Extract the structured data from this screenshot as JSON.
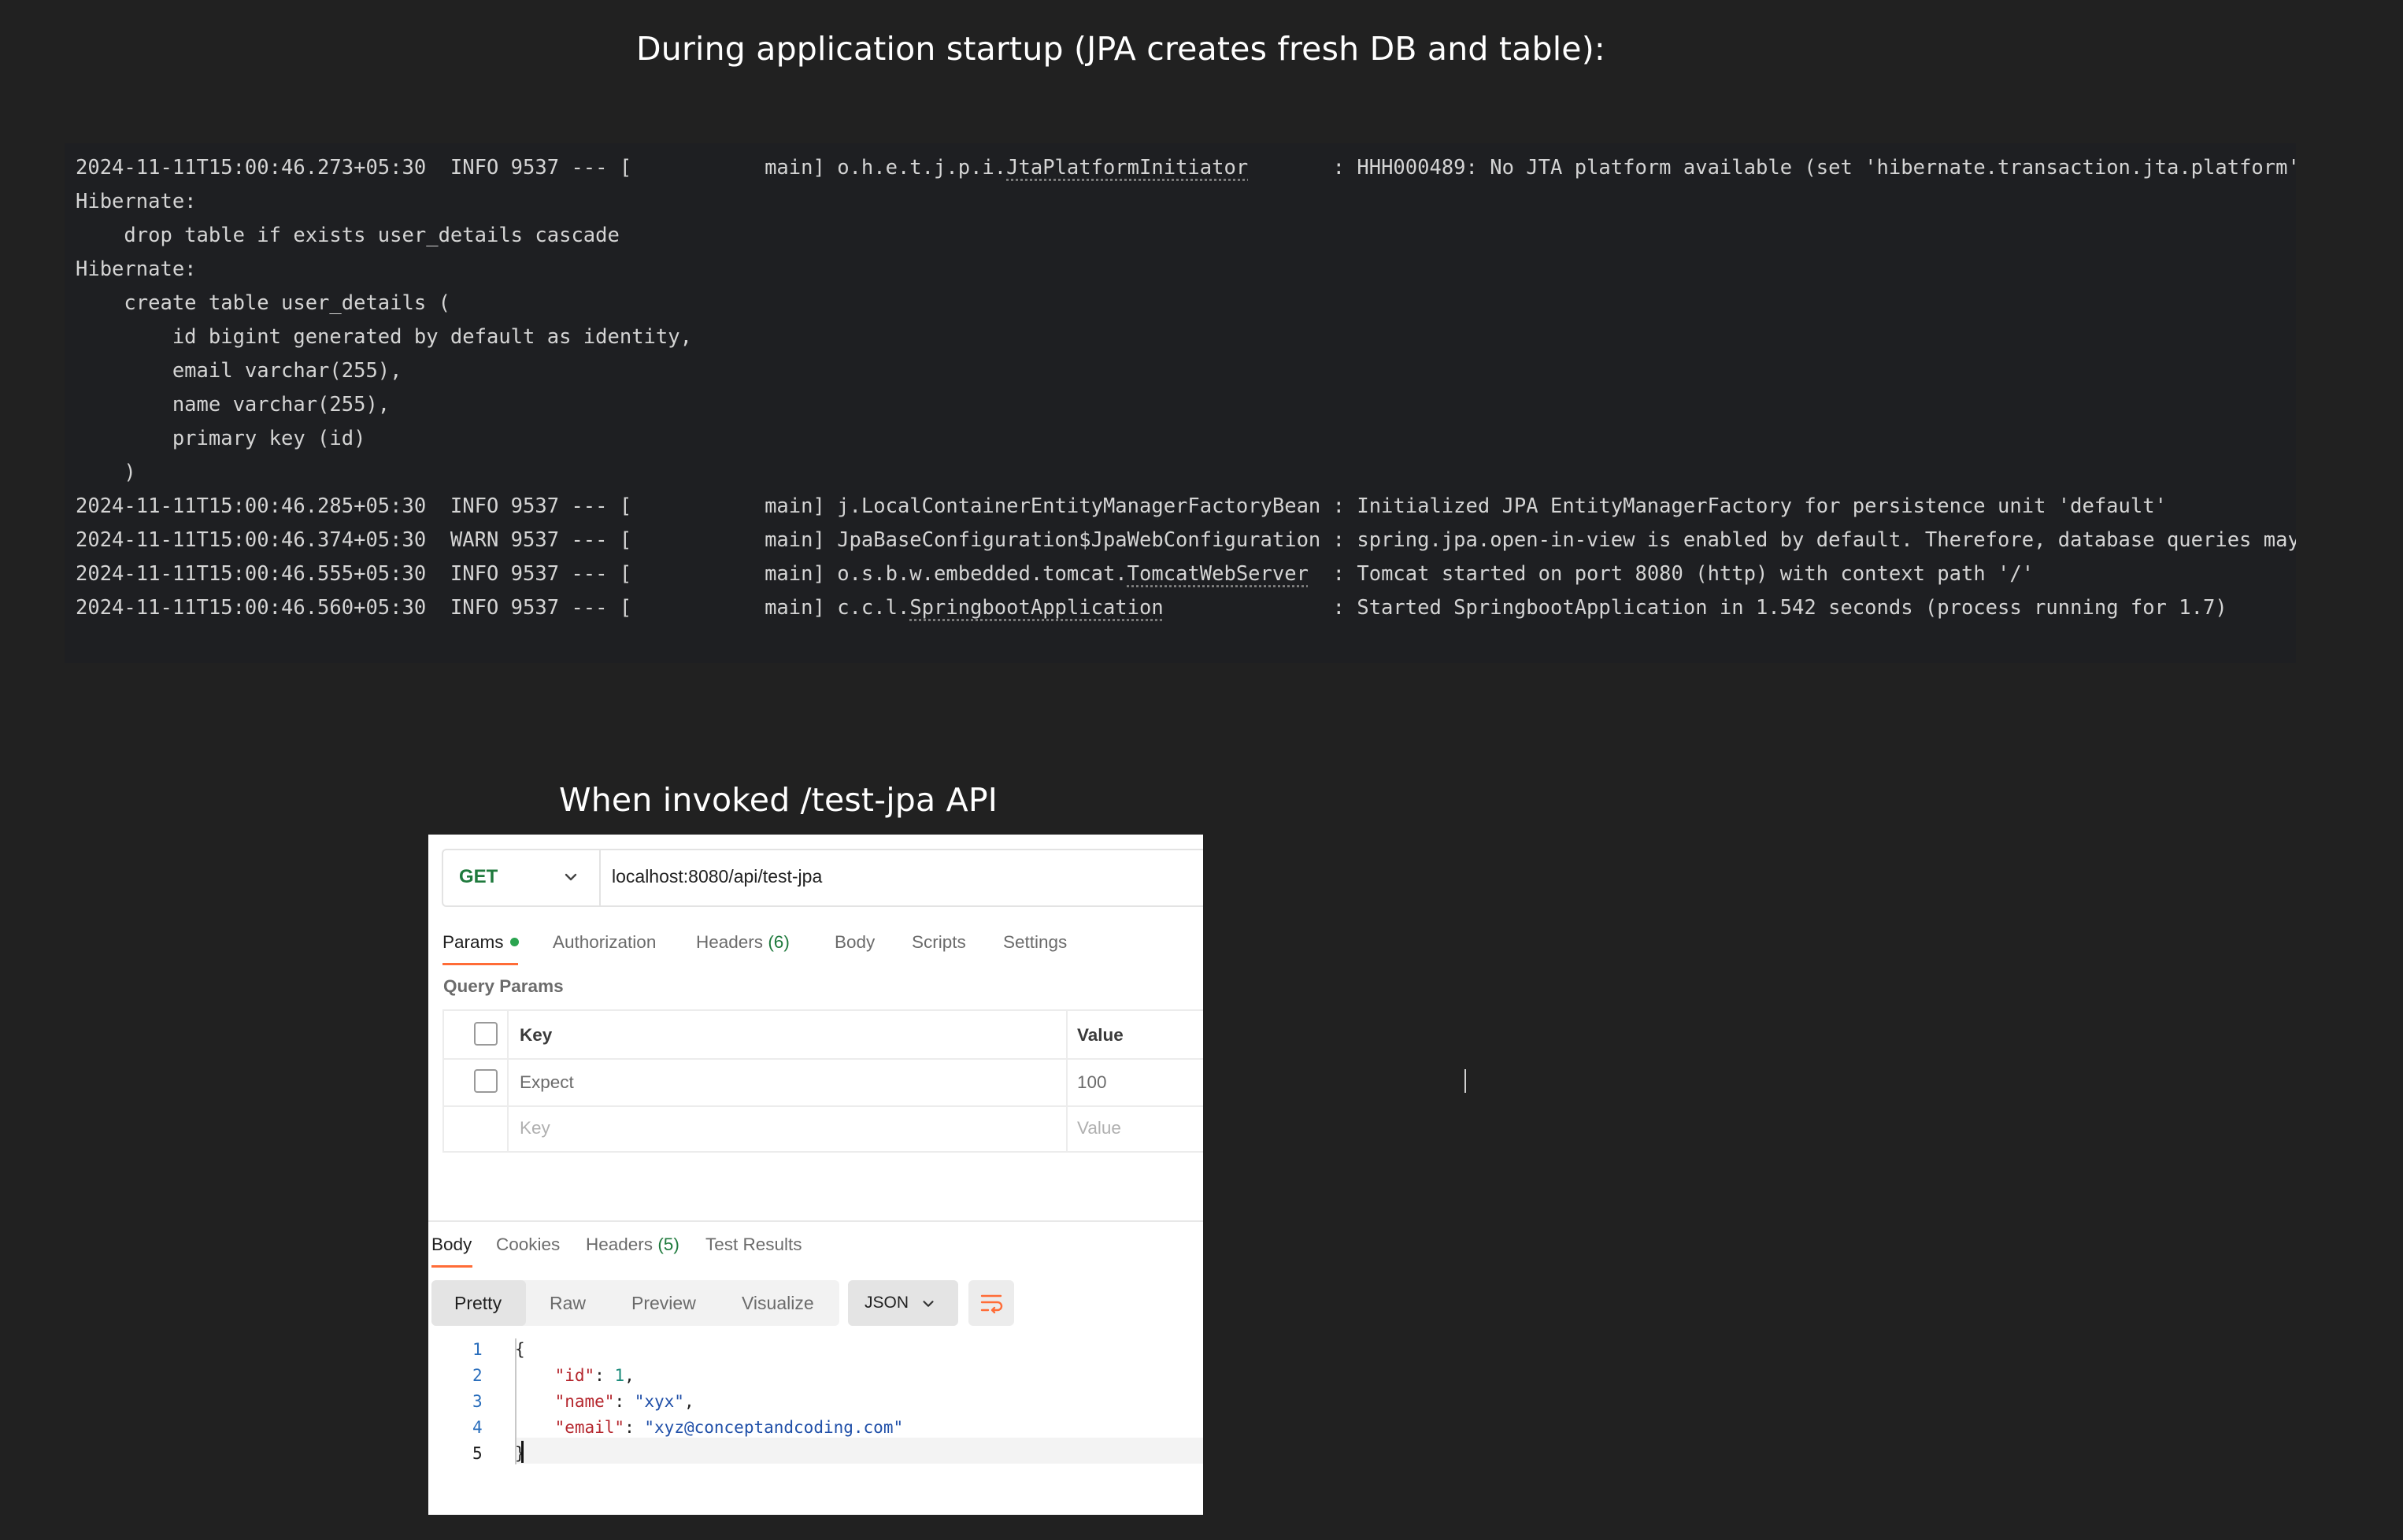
{
  "headings": {
    "startup": "During application startup (JPA creates fresh DB and table):",
    "api": "When invoked /test-jpa API"
  },
  "log": {
    "lines": [
      {
        "segments": [
          "2024-11-11T15:00:46.273+05:30  INFO 9537 --- [           main] o.h.e.t.j.p.i.",
          "JtaPlatformInitiator",
          "       : HHH000489: No JTA platform available (set 'hibernate.transaction.jta.platform' t"
        ]
      },
      {
        "segments": [
          "Hibernate:"
        ]
      },
      {
        "segments": [
          "    drop table if exists user_details cascade"
        ]
      },
      {
        "segments": [
          "Hibernate:"
        ]
      },
      {
        "segments": [
          "    create table user_details ("
        ]
      },
      {
        "segments": [
          "        id bigint generated by default as identity,"
        ]
      },
      {
        "segments": [
          "        email varchar(255),"
        ]
      },
      {
        "segments": [
          "        name varchar(255),"
        ]
      },
      {
        "segments": [
          "        primary key (id)"
        ]
      },
      {
        "segments": [
          "    )"
        ]
      },
      {
        "segments": [
          "2024-11-11T15:00:46.285+05:30  INFO 9537 --- [           main] j.LocalContainerEntityManagerFactoryBean : Initialized JPA EntityManagerFactory for persistence unit 'default'"
        ]
      },
      {
        "segments": [
          "2024-11-11T15:00:46.374+05:30  WARN 9537 --- [           main] JpaBaseConfiguration$JpaWebConfiguration : spring.jpa.open-in-view is enabled by default. Therefore, database queries may b"
        ]
      },
      {
        "segments": [
          "2024-11-11T15:00:46.555+05:30  INFO 9537 --- [           main] o.s.b.w.embedded.tomcat.",
          "TomcatWebServer",
          "  : Tomcat started on port 8080 (http) with context path '/'"
        ]
      },
      {
        "segments": [
          "2024-11-11T15:00:46.560+05:30  INFO 9537 --- [           main] c.c.l.",
          "SpringbootApplication",
          "              : Started SpringbootApplication in 1.542 seconds (process running for 1.7)"
        ]
      }
    ]
  },
  "request": {
    "method": "GET",
    "url": "localhost:8080/api/test-jpa",
    "tabs": [
      {
        "label": "Params",
        "count": "",
        "active": true
      },
      {
        "label": "Authorization",
        "count": "",
        "active": false
      },
      {
        "label": "Headers",
        "count": "(6)",
        "active": false
      },
      {
        "label": "Body",
        "count": "",
        "active": false
      },
      {
        "label": "Scripts",
        "count": "",
        "active": false
      },
      {
        "label": "Settings",
        "count": "",
        "active": false
      }
    ],
    "query_params_label": "Query Params",
    "columns": {
      "key": "Key",
      "value": "Value"
    },
    "rows": [
      {
        "key": "Expect",
        "value": "100"
      }
    ],
    "new_row_placeholder": {
      "key": "Key",
      "value": "Value"
    }
  },
  "response": {
    "tabs": [
      {
        "label": "Body",
        "count": "",
        "active": true
      },
      {
        "label": "Cookies",
        "count": "",
        "active": false
      },
      {
        "label": "Headers",
        "count": "(5)",
        "active": false
      },
      {
        "label": "Test Results",
        "count": "",
        "active": false
      }
    ],
    "formats": [
      "Pretty",
      "Raw",
      "Preview",
      "Visualize"
    ],
    "selected_format": "Pretty",
    "language": "JSON",
    "line_numbers": [
      "1",
      "2",
      "3",
      "4",
      "5"
    ],
    "json": {
      "open": "{",
      "close": "}",
      "id_key": "\"id\"",
      "id_val": "1",
      "name_key": "\"name\"",
      "name_val": "\"xyx\"",
      "email_key": "\"email\"",
      "email_val": "\"xyz@conceptandcoding.com\""
    }
  },
  "colors": {
    "page_bg": "#212121",
    "log_bg": "#1e1f22",
    "get_method": "#1f7a3d",
    "active_tab_underline": "#ff6c37",
    "json_key": "#b5262d",
    "json_string": "#1f4fa8",
    "json_number": "#1a8a7a"
  },
  "icons": {
    "method_dropdown": "chevron-down-icon",
    "language_dropdown": "chevron-down-icon",
    "wrap_lines": "wrap-lines-icon"
  }
}
